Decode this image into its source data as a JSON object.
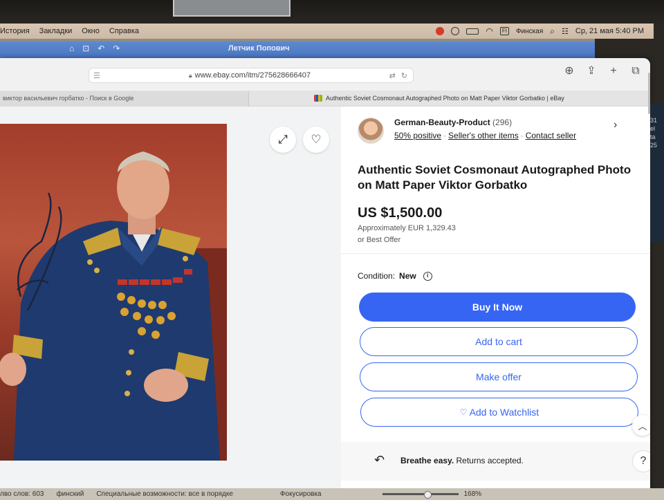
{
  "menubar": {
    "items": [
      "История",
      "Закладки",
      "Окно",
      "Справка"
    ],
    "input_source": "Финская",
    "flag_label": "FI",
    "datetime": "Ср, 21 мая  5:40 PM"
  },
  "background_tab": {
    "title": "Летчик Попович"
  },
  "browser": {
    "url": "www.ebay.com/itm/275628666407",
    "tab_left_label": "виктор васильевич горбатко - Поиск в Google",
    "tab_active_label": "Authentic Soviet Cosmonaut Autographed Photo on Matt Paper Viktor Gorbatko | eBay"
  },
  "listing": {
    "seller_name": "German-Beauty-Product",
    "seller_feedback_count": "(296)",
    "seller_positive": "50% positive",
    "seller_other_items": "Seller's other items",
    "contact_seller": "Contact seller",
    "title": "Authentic Soviet Cosmonaut Autographed Photo on Matt Paper Viktor Gorbatko",
    "price": "US $1,500.00",
    "approx_label": "Approximately",
    "approx_price": "EUR 1,329.43",
    "best_offer": "or Best Offer",
    "condition_label": "Condition:",
    "condition_value": "New",
    "buy_now_label": "Buy It Now",
    "add_to_cart_label": "Add to cart",
    "make_offer_label": "Make offer",
    "watchlist_label": "Add to Watchlist",
    "returns_bold": "Breathe easy.",
    "returns_text": "Returns accepted.",
    "help_label": "?"
  },
  "right_strip": {
    "lines": [
      "31",
      "el",
      "ta",
      "25"
    ]
  },
  "statusbar": {
    "word_count": "лво слов: 603",
    "language": "финский",
    "accessibility": "Специальные возможности: все в порядке",
    "focus": "Фокусировка",
    "zoom": "168%"
  },
  "colors": {
    "accent": "#3665f3",
    "photo_background": "#a33d2c",
    "uniform": "#1f3a6e"
  },
  "icons": [
    "apple-red-icon",
    "play-icon",
    "battery-icon",
    "wifi-icon",
    "search-icon",
    "control-center-icon",
    "download-icon",
    "share-icon",
    "plus-icon",
    "tabs-icon",
    "lock-icon",
    "translate-icon",
    "reload-icon",
    "expand-icon",
    "heart-icon",
    "chevron-right-icon",
    "info-icon",
    "chevron-up-icon",
    "return-icon",
    "help-icon"
  ]
}
